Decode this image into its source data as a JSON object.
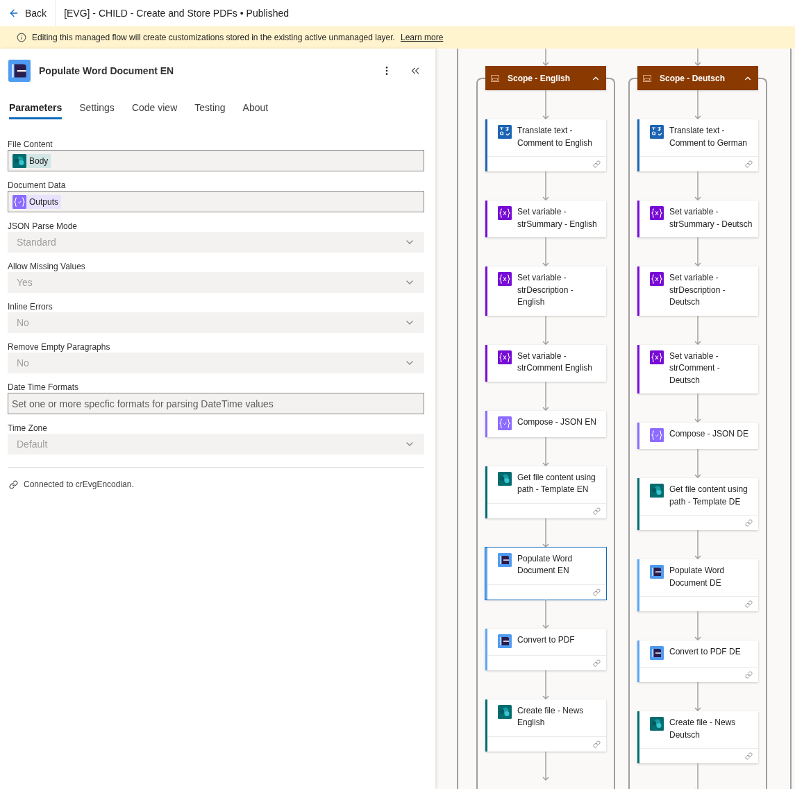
{
  "header": {
    "back": "Back",
    "title": "[EVG] - CHILD - Create and Store PDFs • Published"
  },
  "banner": {
    "text": "Editing this managed flow will create customizations stored in the existing active unmanaged layer.",
    "link": "Learn more"
  },
  "panel": {
    "title": "Populate Word Document EN",
    "tabs": [
      {
        "label": "Parameters",
        "selected": true
      },
      {
        "label": "Settings",
        "selected": false
      },
      {
        "label": "Code view",
        "selected": false
      },
      {
        "label": "Testing",
        "selected": false
      },
      {
        "label": "About",
        "selected": false
      }
    ],
    "fields": [
      {
        "label": "File Content",
        "kind": "token",
        "token": {
          "text": "Body",
          "kind": "sharepoint"
        }
      },
      {
        "label": "Document Data",
        "kind": "token",
        "token": {
          "text": "Outputs",
          "kind": "compose"
        }
      },
      {
        "label": "JSON Parse Mode",
        "kind": "dropdown",
        "value": "Standard",
        "disabled": true
      },
      {
        "label": "Allow Missing Values",
        "kind": "dropdown",
        "value": "Yes",
        "disabled": true
      },
      {
        "label": "Inline Errors",
        "kind": "dropdown",
        "value": "No",
        "disabled": true
      },
      {
        "label": "Remove Empty Paragraphs",
        "kind": "dropdown",
        "value": "No",
        "disabled": true
      },
      {
        "label": "Date Time Formats",
        "kind": "text",
        "placeholder": "Set one or more specfic formats for parsing DateTime values"
      },
      {
        "label": "Time Zone",
        "kind": "dropdown",
        "value": "Default",
        "disabled": true
      }
    ],
    "connection": "Connected to crEvgEncodian."
  },
  "flow": {
    "scopes": [
      {
        "title": "Scope - English",
        "expanded": true,
        "actions": [
          {
            "title": "Translate text - Comment to English",
            "kind": "translate",
            "selected": false,
            "connected": true
          },
          {
            "title": "Set variable - strSummary - English",
            "kind": "variable",
            "selected": false,
            "connected": false
          },
          {
            "title": "Set variable - strDescription - English",
            "kind": "variable",
            "selected": false,
            "connected": false
          },
          {
            "title": "Set variable - strComment English",
            "kind": "variable",
            "selected": false,
            "connected": false
          },
          {
            "title": "Compose - JSON EN",
            "kind": "compose",
            "selected": false,
            "connected": false
          },
          {
            "title": "Get file content using path - Template EN",
            "kind": "sharepoint",
            "selected": false,
            "connected": true
          },
          {
            "title": "Populate Word Document EN",
            "kind": "encodian",
            "selected": true,
            "connected": true
          },
          {
            "title": "Convert to PDF",
            "kind": "encodian",
            "selected": false,
            "connected": true
          },
          {
            "title": "Create file - News English",
            "kind": "sharepoint",
            "selected": false,
            "connected": true
          }
        ]
      },
      {
        "title": "Scope - Deutsch",
        "expanded": true,
        "actions": [
          {
            "title": "Translate text - Comment to German",
            "kind": "translate",
            "selected": false,
            "connected": true
          },
          {
            "title": "Set variable - strSummary - Deutsch",
            "kind": "variable",
            "selected": false,
            "connected": false
          },
          {
            "title": "Set variable - strDescription - Deutsch",
            "kind": "variable",
            "selected": false,
            "connected": false
          },
          {
            "title": "Set variable - strComment - Deutsch",
            "kind": "variable",
            "selected": false,
            "connected": false
          },
          {
            "title": "Compose - JSON DE",
            "kind": "compose",
            "selected": false,
            "connected": false
          },
          {
            "title": "Get file content using path - Template DE",
            "kind": "sharepoint",
            "selected": false,
            "connected": true
          },
          {
            "title": "Populate Word Document DE",
            "kind": "encodian",
            "selected": false,
            "connected": true
          },
          {
            "title": "Convert to PDF DE",
            "kind": "encodian",
            "selected": false,
            "connected": true
          },
          {
            "title": "Create file - News Deutsch",
            "kind": "sharepoint",
            "selected": false,
            "connected": true
          }
        ]
      }
    ]
  }
}
